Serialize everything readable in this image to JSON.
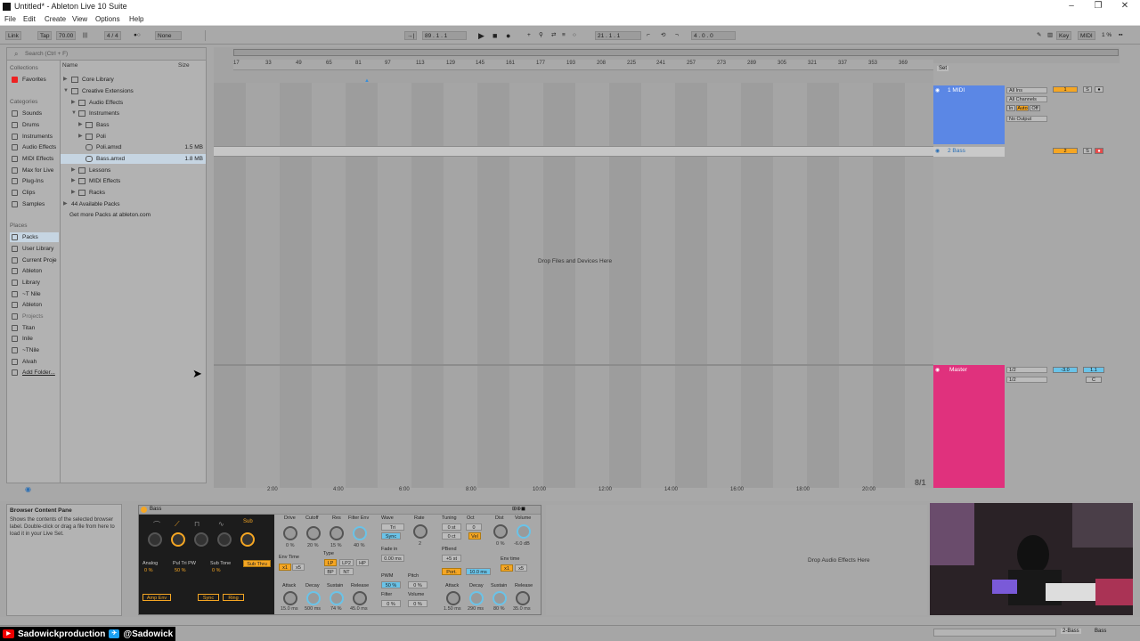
{
  "window": {
    "title": "Untitled* - Ableton Live 10 Suite"
  },
  "menu": [
    "File",
    "Edit",
    "Create",
    "View",
    "Options",
    "Help"
  ],
  "control_bar": {
    "link": "Link",
    "tap": "Tap",
    "tempo": "70.00",
    "signature": "4 / 4",
    "quantize": "None",
    "position": "89 . 1 . 1",
    "loop_start": "21 . 1 . 1",
    "loop_length": "4 . 0 . 0",
    "key": "Key",
    "midi": "MIDI",
    "cpu": "1 %"
  },
  "browser": {
    "search_placeholder": "Search (Ctrl + F)",
    "collections_header": "Collections",
    "collections": [
      "Favorites"
    ],
    "categories_header": "Categories",
    "categories": [
      "Sounds",
      "Drums",
      "Instruments",
      "Audio Effects",
      "MIDI Effects",
      "Max for Live",
      "Plug-Ins",
      "Clips",
      "Samples"
    ],
    "places_header": "Places",
    "places": [
      "Packs",
      "User Library",
      "Current Proje",
      "Ableton",
      "Library",
      "~T Nile",
      "Ableton",
      "Projects",
      "Titan",
      "Inile",
      "~TNile",
      "Alvah",
      "Add Folder..."
    ],
    "columns": {
      "name": "Name",
      "size": "Size"
    },
    "files": [
      {
        "name": "Core Library",
        "size": ""
      },
      {
        "name": "Creative Extensions",
        "size": ""
      },
      {
        "name": "Audio Effects",
        "size": ""
      },
      {
        "name": "Instruments",
        "size": ""
      },
      {
        "name": "Bass",
        "size": ""
      },
      {
        "name": "Poli",
        "size": ""
      },
      {
        "name": "Poli.amxd",
        "size": "1.5 MB"
      },
      {
        "name": "Bass.amxd",
        "size": "1.8 MB"
      },
      {
        "name": "Lessons",
        "size": ""
      },
      {
        "name": "MIDI Effects",
        "size": ""
      },
      {
        "name": "Racks",
        "size": ""
      },
      {
        "name": "44 Available Packs",
        "size": ""
      },
      {
        "name": "Get more Packs at ableton.com",
        "size": ""
      }
    ]
  },
  "arrangement": {
    "ruler": [
      "17",
      "33",
      "49",
      "65",
      "81",
      "97",
      "113",
      "129",
      "145",
      "161",
      "177",
      "193",
      "208",
      "225",
      "241",
      "257",
      "273",
      "289",
      "305",
      "321",
      "337",
      "353",
      "369"
    ],
    "times": [
      "2:00",
      "4:00",
      "6:00",
      "8:00",
      "10:00",
      "12:00",
      "14:00",
      "16:00",
      "18:00",
      "20:00"
    ],
    "drop_hint": "Drop Files and Devices Here",
    "set_label": "Set",
    "ratio": "8/1"
  },
  "tracks": [
    {
      "name": "1 MIDI",
      "input": "All Ins",
      "channel": "All Channels",
      "monitor": [
        "In",
        "Auto",
        "Off"
      ],
      "output": "No Output",
      "number": "1",
      "solo": "S",
      "color": "#5b87e5"
    },
    {
      "name": "2 Bass",
      "number": "2",
      "solo": "S",
      "color": "#c9c9c9"
    }
  ],
  "master": {
    "name": "Master",
    "io1": "1/2",
    "io2": "1/2",
    "volume": "-3.0",
    "pan": "1.1",
    "cue": "C",
    "color": "#e0317d"
  },
  "info": {
    "title": "Browser Content Pane",
    "body": "Shows the contents of the selected browser label. Double-click or drag a file from here to load it in your Live Set."
  },
  "device": {
    "name": "Bass",
    "osc_labels": [
      "Analog",
      "Pul Tri PW",
      "Sub Tone",
      "Sub Thru"
    ],
    "osc_values": [
      "0 %",
      "50 %",
      "0 %"
    ],
    "sub_label": "Sub",
    "env_time": "Env Time",
    "env_mult": [
      "x1",
      "x5"
    ],
    "amp_env": "Amp Env",
    "sync": "Sync",
    "ring": "Ring",
    "filter_labels": [
      "Drive",
      "Cutoff",
      "Res",
      "Filter Env"
    ],
    "filter_values": [
      "0 %",
      "20 %",
      "15 %",
      "40 %"
    ],
    "type_label": "Type",
    "types": [
      "LP",
      "LP2",
      "HP",
      "BP",
      "NT"
    ],
    "adsr_labels": [
      "Attack",
      "Decay",
      "Sustain",
      "Release"
    ],
    "adsr1_values": [
      "15.0 ms",
      "500 ms",
      "74 %",
      "45.0 ms"
    ],
    "wave_label": "Wave",
    "wave": "Tri",
    "wsync": "Sync",
    "rate": "Rate",
    "rate_value": "2",
    "fade_in": "Fade in",
    "fade_value": "0.00 ms",
    "pwm": "PWM",
    "pitch": "Pitch",
    "pwm_value": "50 %",
    "pitch_value": "0 %",
    "filter": "Filter",
    "volume": "Volume",
    "filter_value": "0 %",
    "volume_value": "0 %",
    "tuning": "Tuning",
    "oct": "Oct",
    "dist": "Dist",
    "vol2": "Volume",
    "tuning_values": [
      "0 st",
      "0 ct"
    ],
    "oct_value": "0",
    "vel": "Vel",
    "dist_value": "0 %",
    "vol2_value": "-6.0 dB",
    "pbend": "PBend",
    "pbend_value": "+5 st",
    "port": "Port.",
    "port_value": "10.0 ms",
    "env_time2": "Env time",
    "adsr2_values": [
      "1.50 ms",
      "290 ms",
      "80 %",
      "35.0 ms"
    ]
  },
  "audio_fx_hint": "Drop Audio Effects Here",
  "status": {
    "track": "2-Bass",
    "device": "Bass"
  },
  "social": {
    "youtube": "Sadowickproduction",
    "twitter": "@Sadowick"
  }
}
